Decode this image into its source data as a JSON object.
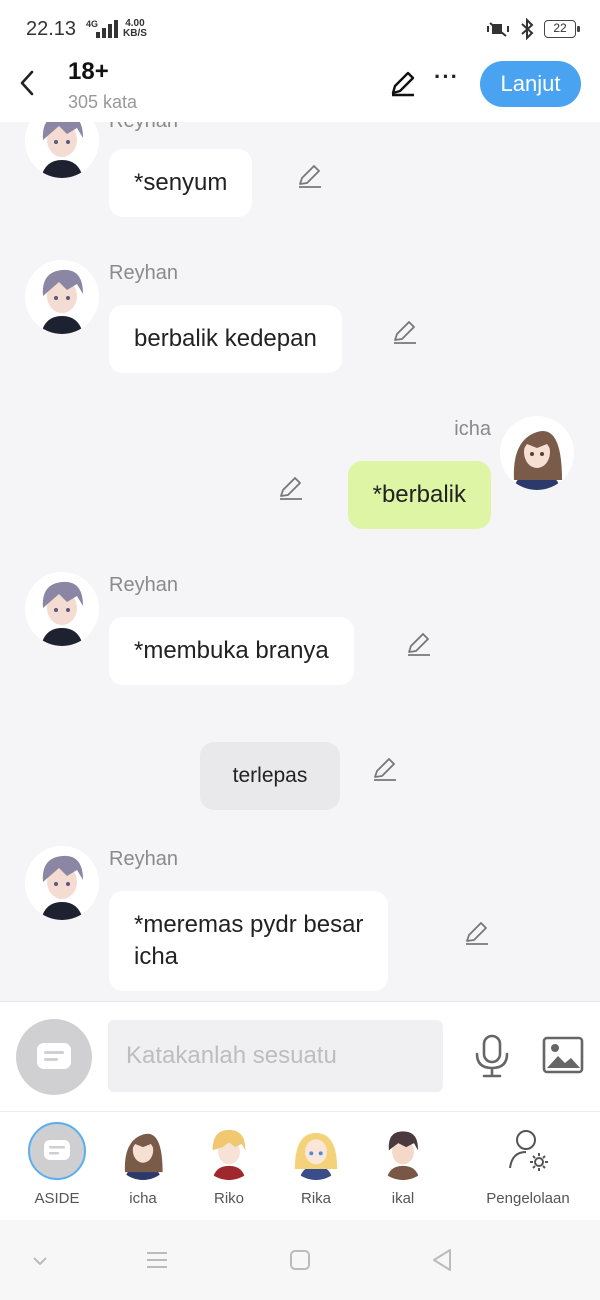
{
  "status_bar": {
    "time": "22.13",
    "network": "4G",
    "speed_value": "4.00",
    "speed_unit": "KB/S",
    "battery": "22"
  },
  "header": {
    "title": "18+",
    "subtitle": "305 kata",
    "next_label": "Lanjut",
    "more_label": "···"
  },
  "messages": [
    {
      "sender": "Reyhan",
      "text": "*senyum",
      "side": "left"
    },
    {
      "sender": "Reyhan",
      "text": "berbalik kedepan",
      "side": "left"
    },
    {
      "sender": "icha",
      "text": "*berbalik",
      "side": "right"
    },
    {
      "sender": "Reyhan",
      "text": "*membuka branya",
      "side": "left"
    },
    {
      "sender": "",
      "text": "terlepas",
      "side": "aside"
    },
    {
      "sender": "Reyhan",
      "text": "*meremas pydr besar",
      "text2": "icha",
      "side": "left"
    }
  ],
  "input": {
    "placeholder": "Katakanlah sesuatu"
  },
  "characters": [
    {
      "label": "ASIDE"
    },
    {
      "label": "icha"
    },
    {
      "label": "Riko"
    },
    {
      "label": "Rika"
    },
    {
      "label": "ikal"
    },
    {
      "label": "Pengelolaan"
    }
  ],
  "colors": {
    "accent": "#4aa3f0",
    "my_bubble": "#dff5a6",
    "aside_bubble": "#e9e9ec"
  }
}
